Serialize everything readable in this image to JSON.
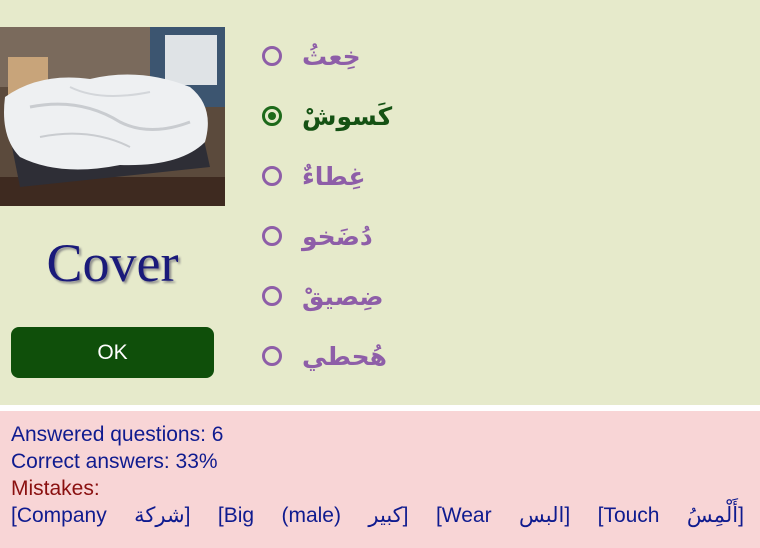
{
  "quiz": {
    "word": "Cover",
    "ok_label": "OK",
    "options": [
      {
        "label": "خِعثُ",
        "selected": false
      },
      {
        "label": "كَسوشْ",
        "selected": true
      },
      {
        "label": "غِطاءٌ",
        "selected": false
      },
      {
        "label": "دُضَخو",
        "selected": false
      },
      {
        "label": "ضِصيقْ",
        "selected": false
      },
      {
        "label": "هُحطي",
        "selected": false
      }
    ]
  },
  "stats": {
    "answered": "Answered questions: 6",
    "correct": "Correct answers: 33%",
    "mistakes_label": "Mistakes:",
    "mistake_tokens": [
      "[Company",
      "شركة]",
      "[Big",
      "(male)",
      "كبير]",
      "[Wear",
      "البس]",
      "[Touch",
      "أَلْمِسُ]"
    ]
  },
  "colors": {
    "quiz_bg": "#e6eacb",
    "stats_bg": "#f8d5d6",
    "ok_bg": "#0f4f0a",
    "option_color": "#8e5ea8",
    "selected_color": "#155214"
  }
}
